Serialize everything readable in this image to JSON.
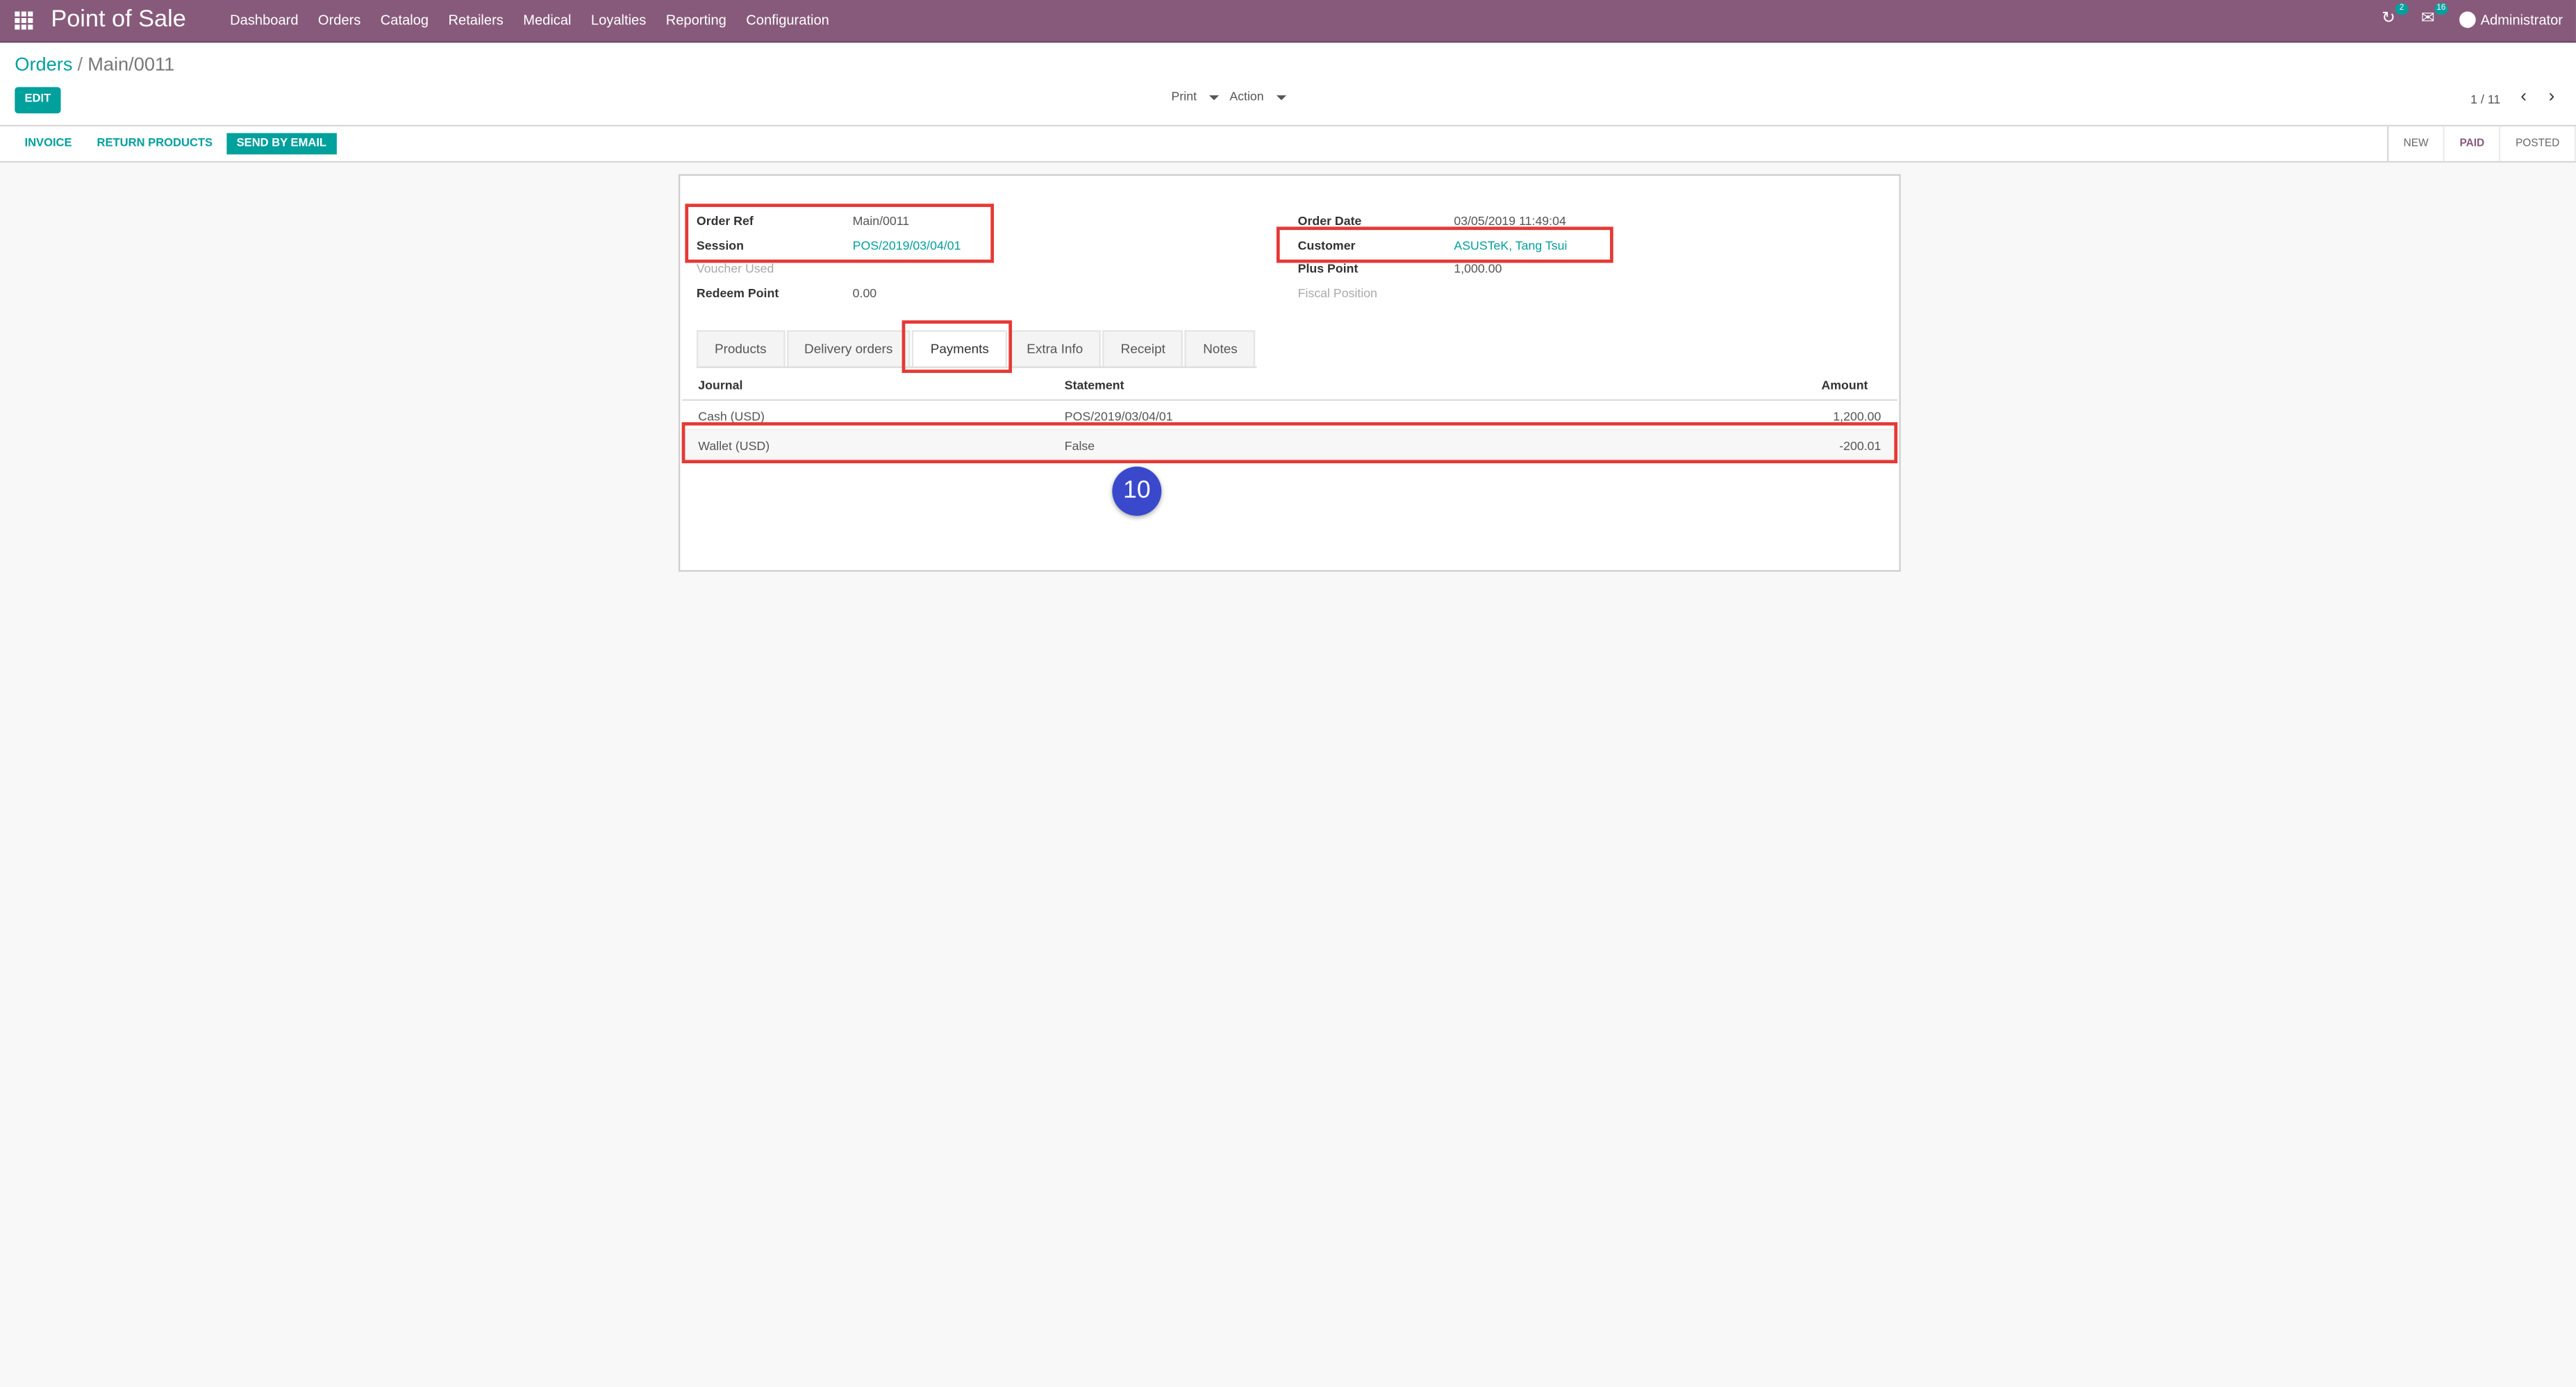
{
  "topbar": {
    "app_title": "Point of Sale",
    "menu": [
      "Dashboard",
      "Orders",
      "Catalog",
      "Retailers",
      "Medical",
      "Loyalties",
      "Reporting",
      "Configuration"
    ],
    "activity_count": "2",
    "messages_count": "16",
    "user_name": "Administrator"
  },
  "control_panel": {
    "breadcrumb_parent": "Orders",
    "breadcrumb_sep": "/",
    "breadcrumb_current": "Main/0011",
    "edit_label": "EDIT",
    "print_label": "Print",
    "action_label": "Action",
    "pager": "1 / 11"
  },
  "statusbar": {
    "invoice_label": "INVOICE",
    "return_label": "RETURN PRODUCTS",
    "email_label": "SEND BY EMAIL",
    "states": [
      "NEW",
      "PAID",
      "POSTED"
    ],
    "active_state": "PAID"
  },
  "form": {
    "order_ref_label": "Order Ref",
    "order_ref": "Main/0011",
    "session_label": "Session",
    "session": "POS/2019/03/04/01",
    "voucher_label": "Voucher Used",
    "redeem_label": "Redeem Point",
    "redeem_value": "0.00",
    "order_date_label": "Order Date",
    "order_date": "03/05/2019 11:49:04",
    "customer_label": "Customer",
    "customer": "ASUSTeK, Tang Tsui",
    "plus_point_label": "Plus Point",
    "plus_point": "1,000.00",
    "fiscal_label": "Fiscal Position"
  },
  "tabs": [
    "Products",
    "Delivery orders",
    "Payments",
    "Extra Info",
    "Receipt",
    "Notes"
  ],
  "active_tab": "Payments",
  "payments": {
    "headers": {
      "journal": "Journal",
      "statement": "Statement",
      "amount": "Amount"
    },
    "rows": [
      {
        "journal": "Cash (USD)",
        "statement": "POS/2019/03/04/01",
        "amount": "1,200.00"
      },
      {
        "journal": "Wallet (USD)",
        "statement": "False",
        "amount": "-200.01"
      }
    ]
  },
  "step_badge": "10",
  "colors": {
    "brand": "#875a7b",
    "accent": "#00a09d",
    "highlight": "#e53935",
    "badge": "#3a49cc"
  }
}
